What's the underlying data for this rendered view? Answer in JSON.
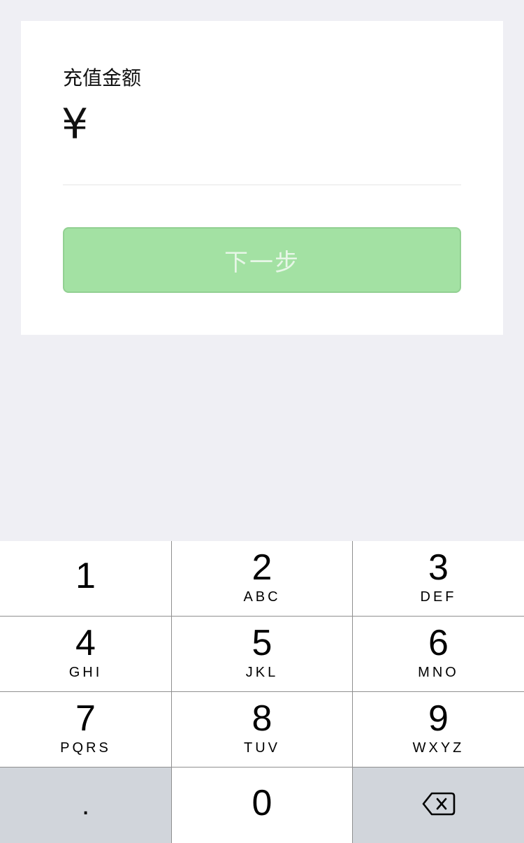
{
  "form": {
    "title": "充值金额",
    "currency_symbol": "¥",
    "amount_value": "",
    "next_label": "下一步"
  },
  "keypad": {
    "keys": [
      {
        "digit": "1",
        "letters": ""
      },
      {
        "digit": "2",
        "letters": "ABC"
      },
      {
        "digit": "3",
        "letters": "DEF"
      },
      {
        "digit": "4",
        "letters": "GHI"
      },
      {
        "digit": "5",
        "letters": "JKL"
      },
      {
        "digit": "6",
        "letters": "MNO"
      },
      {
        "digit": "7",
        "letters": "PQRS"
      },
      {
        "digit": "8",
        "letters": "TUV"
      },
      {
        "digit": "9",
        "letters": "WXYZ"
      }
    ],
    "dot": ".",
    "zero": "0",
    "backspace_icon": "backspace-icon"
  },
  "colors": {
    "background": "#efeff4",
    "button_disabled_green": "#a3e1a3",
    "key_gray": "#d1d5db"
  }
}
